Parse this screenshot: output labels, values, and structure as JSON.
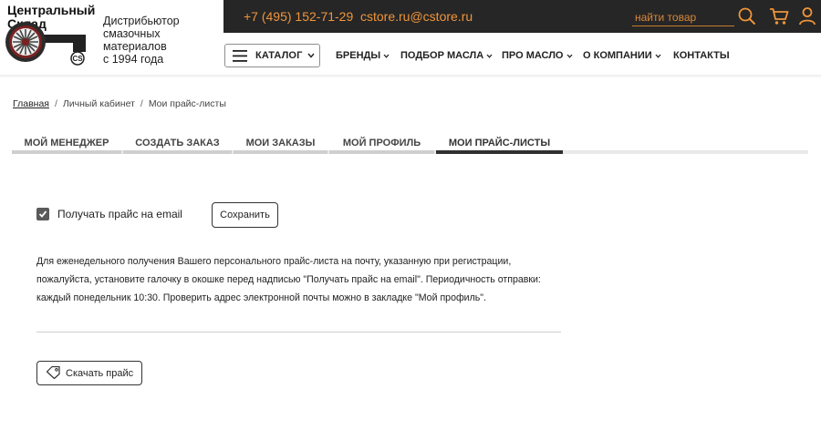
{
  "logo": {
    "title_line1": "Центральный",
    "title_line2": "Склад",
    "emblem_text": "CS",
    "tagline_line1": "Дистрибьютор",
    "tagline_line2": "смазочных материалов",
    "tagline_line3": "с 1994 года"
  },
  "topbar": {
    "phone": "+7 (495) 152-71-29",
    "email": "cstore.ru@cstore.ru",
    "search_placeholder": "найти товар",
    "icons": [
      "search-icon",
      "cart-icon",
      "user-icon"
    ]
  },
  "nav": {
    "catalog_label": "КАТАЛОГ",
    "items": [
      {
        "label": "БРЕНДЫ",
        "has_dropdown": true
      },
      {
        "label": "ПОДБОР МАСЛА",
        "has_dropdown": true
      },
      {
        "label": "ПРО МАСЛО",
        "has_dropdown": true
      },
      {
        "label": "О КОМПАНИИ",
        "has_dropdown": true
      },
      {
        "label": "КОНТАКТЫ",
        "has_dropdown": false
      }
    ]
  },
  "breadcrumb": {
    "items": [
      "Главная",
      "Личный кабинет",
      "Мои прайс-листы"
    ],
    "separator": "/"
  },
  "tabs": [
    {
      "label": "МОЙ МЕНЕДЖЕР",
      "active": false
    },
    {
      "label": "СОЗДАТЬ ЗАКАЗ",
      "active": false
    },
    {
      "label": "МОИ ЗАКАЗЫ",
      "active": false
    },
    {
      "label": "МОЙ ПРОФИЛЬ",
      "active": false
    },
    {
      "label": "МОИ ПРАЙС-ЛИСТЫ",
      "active": true
    }
  ],
  "content": {
    "checkbox_label": "Получать прайс на email",
    "checkbox_checked": true,
    "save_label": "Сохранить",
    "info_line1": "Для еженедельного получения Вашего персонального прайс-листа на почту, указанную при регистрации,",
    "info_line2": "пожалуйста, установите галочку в окошке перед надписью \"Получать прайс на email\". Периодичность отправки:",
    "info_line3": "каждый понедельник 10:30. Проверить адрес электронной почты можно в закладке \"Мой профиль\".",
    "download_label": "Скачать прайс"
  },
  "colors": {
    "accent": "#f0953a",
    "topbar_bg": "#262626",
    "active_tab_line": "#303030"
  }
}
